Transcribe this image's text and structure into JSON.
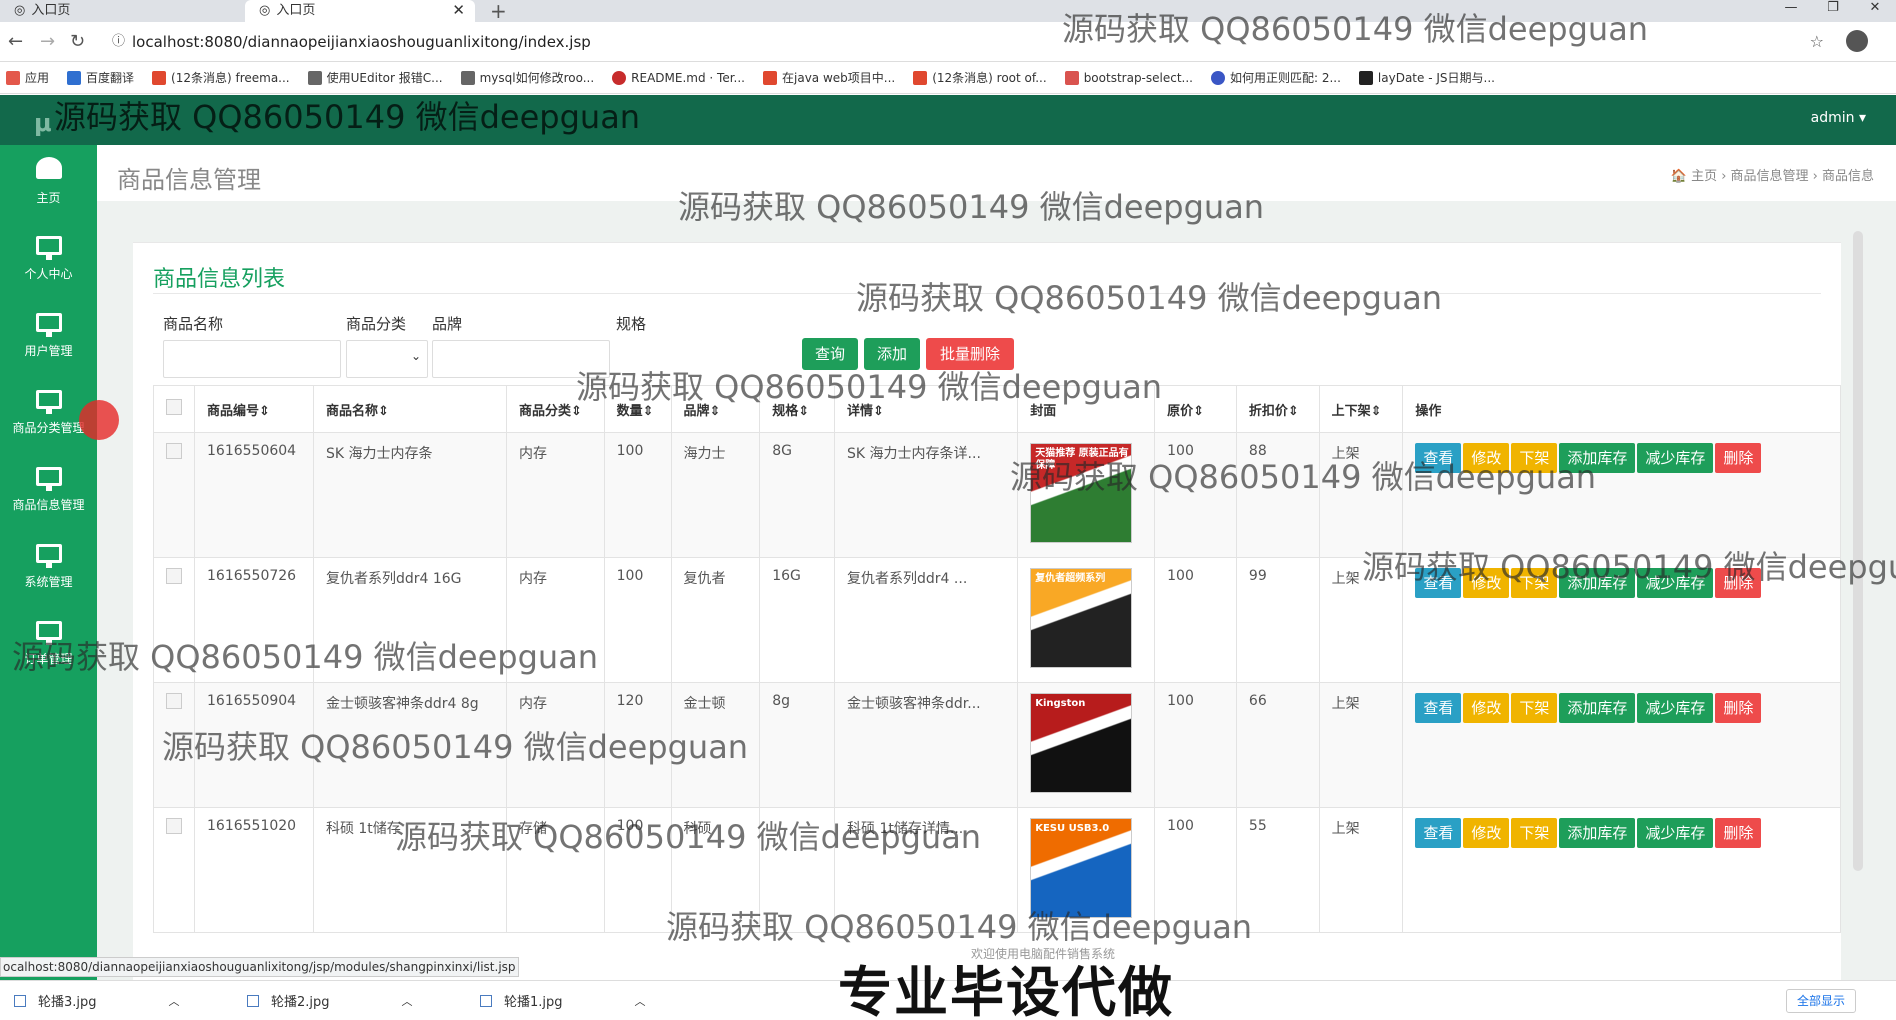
{
  "browser": {
    "tabs": [
      {
        "title": "入口页"
      },
      {
        "title": "入口页"
      }
    ],
    "url": "localhost:8080/diannaopeijianxiaoshouguanlixitong/index.jsp",
    "bookmarks": [
      "应用",
      "百度翻译",
      "(12条消息) freema...",
      "使用UEditor 报错C...",
      "mysql如何修改roo...",
      "README.md · Ter...",
      "在java web项目中...",
      "(12条消息) root of...",
      "bootstrap-select...",
      "如何用正则匹配: 2...",
      "layDate - JS日期与..."
    ],
    "status_url": "ocalhost:8080/diannaopeijianxiaoshouguanlixitong/jsp/modules/shangpinxinxi/list.jsp"
  },
  "app": {
    "logo": "μ",
    "user": "admin ▾",
    "sidebar": [
      "主页",
      "个人中心",
      "用户管理",
      "商品分类管理",
      "商品信息管理",
      "系统管理",
      "订单管理"
    ],
    "page_title": "商品信息管理",
    "breadcrumb": "🏠 主页  ›  商品信息管理  ›  商品信息",
    "card_title": "商品信息列表",
    "search": {
      "name_label": "商品名称",
      "category_label": "商品分类",
      "brand_label": "品牌",
      "spec_label": "规格"
    },
    "buttons": {
      "query": "查询",
      "add": "添加",
      "batch_delete": "批量删除"
    },
    "columns": [
      "商品编号⇕",
      "商品名称⇕",
      "商品分类⇕",
      "数量⇕",
      "品牌⇕",
      "规格⇕",
      "详情⇕",
      "封面",
      "原价⇕",
      "折扣价⇕",
      "上下架⇕",
      "操作"
    ],
    "rows": [
      {
        "id": "1616550604",
        "name": "SK 海力士内存条",
        "category": "内存",
        "qty": "100",
        "brand": "海力士",
        "spec": "8G",
        "detail": "SK 海力士内存条详...",
        "price": "100",
        "discount": "88",
        "status": "上架"
      },
      {
        "id": "1616550726",
        "name": "复仇者系列ddr4 16G",
        "category": "内存",
        "qty": "100",
        "brand": "复仇者",
        "spec": "16G",
        "detail": "复仇者系列ddr4 ...",
        "price": "100",
        "discount": "99",
        "status": "上架"
      },
      {
        "id": "1616550904",
        "name": "金士顿骇客神条ddr4 8g",
        "category": "内存",
        "qty": "120",
        "brand": "金士顿",
        "spec": "8g",
        "detail": "金士顿骇客神条ddr...",
        "price": "100",
        "discount": "66",
        "status": "上架"
      },
      {
        "id": "1616551020",
        "name": "科硕 1t储存",
        "category": "存储",
        "qty": "100",
        "brand": "科硕",
        "spec": "",
        "detail": "科硕 1t储存详情...",
        "price": "100",
        "discount": "55",
        "status": "上架"
      }
    ],
    "row_actions": {
      "view": "查看",
      "edit": "修改",
      "offshelf": "下架",
      "add_stock": "添加库存",
      "reduce_stock": "减少库存",
      "delete": "删除"
    },
    "cover_labels": [
      "天猫推荐 原装正品有保障",
      "复仇者超频系列",
      "Kingston",
      "KESU USB3.0"
    ],
    "footer": "欢迎使用电脑配件销售系统"
  },
  "downloads": {
    "items": [
      "轮播3.jpg",
      "轮播2.jpg",
      "轮播1.jpg"
    ],
    "show_all": "全部显示"
  },
  "overlay": {
    "watermark": "源码获取 QQ86050149 微信deepguan",
    "slogan": "专业毕设代做"
  },
  "colors": {
    "primary_green": "#16a05f",
    "dark_green": "#12694b",
    "info": "#2aa0c5",
    "warning": "#f0b400",
    "success": "#1e9e5a",
    "danger": "#ee4b4b"
  }
}
